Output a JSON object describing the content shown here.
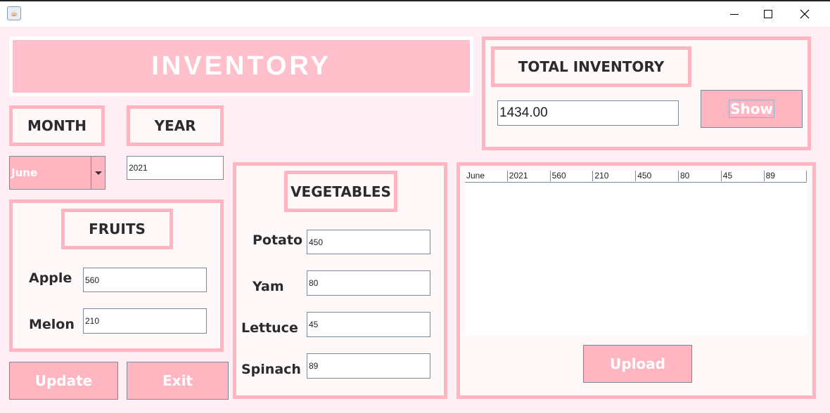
{
  "window": {
    "app_icon": "java-icon",
    "controls": [
      "minimize-icon",
      "maximize-icon",
      "close-icon"
    ]
  },
  "banner": {
    "title": "INVENTORY"
  },
  "month": {
    "label": "MONTH",
    "selected": "June"
  },
  "year": {
    "label": "YEAR",
    "value": "2021"
  },
  "fruits": {
    "title": "FRUITS",
    "items": [
      {
        "label": "Apple",
        "value": "560"
      },
      {
        "label": "Melon",
        "value": "210"
      }
    ]
  },
  "vegetables": {
    "title": "VEGETABLES",
    "items": [
      {
        "label": "Potato",
        "value": "450"
      },
      {
        "label": "Yam",
        "value": "80"
      },
      {
        "label": "Lettuce",
        "value": "45"
      },
      {
        "label": "Spinach",
        "value": "89"
      }
    ]
  },
  "total": {
    "title": "TOTAL INVENTORY",
    "value": "1434.00",
    "show_label": "Show"
  },
  "table": {
    "columns": [
      "June",
      "2021",
      "560",
      "210",
      "450",
      "80",
      "45",
      "89"
    ]
  },
  "buttons": {
    "update": "Update",
    "exit": "Exit",
    "upload": "Upload"
  },
  "colors": {
    "accent": "#ffb6c1",
    "banner": "#ffc0cb",
    "background": "#ffeef3"
  }
}
